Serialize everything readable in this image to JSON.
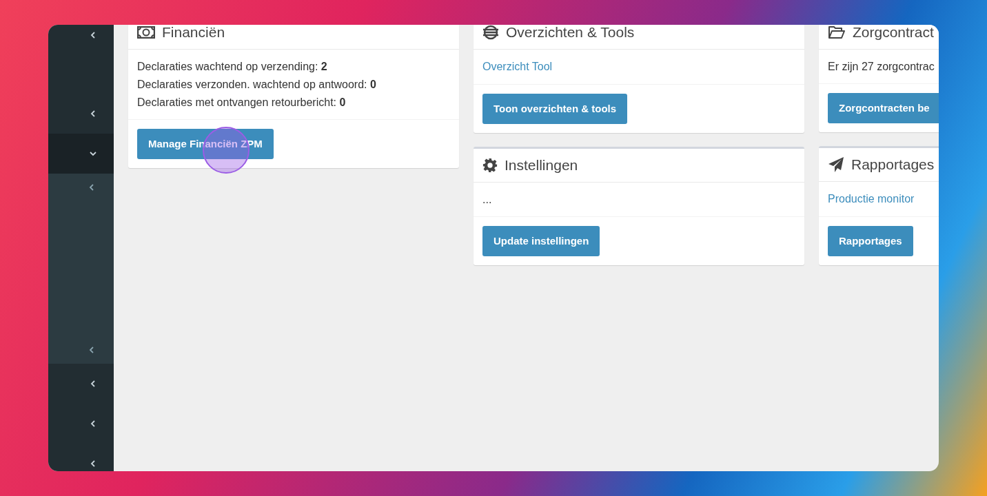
{
  "sidebar": {
    "items": [
      {
        "expanded": false
      },
      {
        "expanded": false
      },
      {
        "expanded": true,
        "children": [
          {
            "expanded": false
          },
          {
            "expanded": false
          }
        ]
      },
      {
        "expanded": false
      },
      {
        "expanded": false
      },
      {
        "expanded": false
      }
    ]
  },
  "columns": [
    {
      "cards": [
        {
          "kind": "finance",
          "title": "Financiën",
          "body": [
            {
              "kind": "text",
              "text": "Declaraties wachtend op verzending: **2**"
            },
            {
              "kind": "text",
              "text": "Declaraties verzonden. wachtend op antwoord: **0**"
            },
            {
              "kind": "text",
              "text": "Declaraties met ontvangen retourbericht: **0**"
            }
          ],
          "button": "Manage Financiën ZPM"
        }
      ]
    },
    {
      "cards": [
        {
          "kind": "overview",
          "title": "Overzichten & Tools",
          "body": [
            {
              "kind": "link",
              "text": "Overzicht Tool"
            }
          ],
          "button": "Toon overzichten & tools"
        },
        {
          "kind": "settings",
          "title": "Instellingen",
          "body": [
            {
              "kind": "text",
              "text": "..."
            }
          ],
          "button": "Update instellingen"
        }
      ]
    },
    {
      "cards": [
        {
          "kind": "contracts",
          "title": "Zorgcontract",
          "body": [
            {
              "kind": "text",
              "text": "Er zijn 27 zorgcontrac"
            }
          ],
          "button": "Zorgcontracten be"
        },
        {
          "kind": "reports",
          "title": "Rapportages",
          "body": [
            {
              "kind": "link",
              "text": "Productie monitor"
            }
          ],
          "button": "Rapportages"
        }
      ]
    }
  ]
}
